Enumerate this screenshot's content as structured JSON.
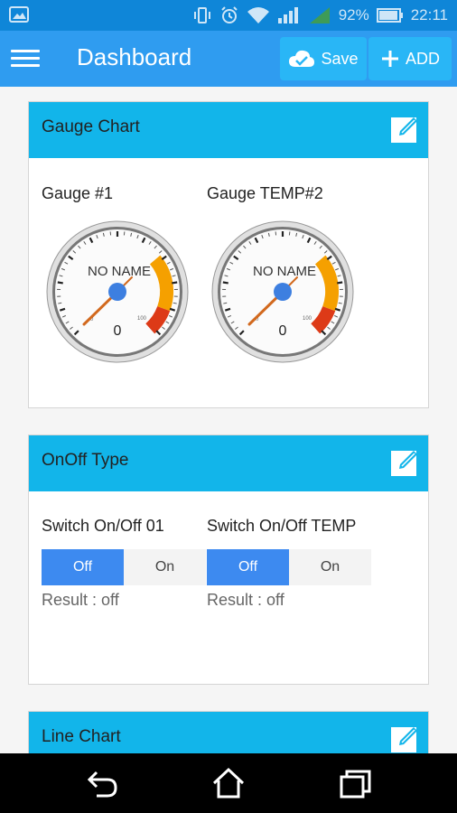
{
  "status_bar": {
    "battery": "92%",
    "time": "22:11"
  },
  "app_bar": {
    "title": "Dashboard",
    "save_label": "Save",
    "add_label": "ADD"
  },
  "panels": {
    "gauge": {
      "title": "Gauge Chart",
      "gauges": [
        {
          "label": "Gauge #1",
          "name": "NO NAME",
          "value": "0",
          "min": "0",
          "max": "100"
        },
        {
          "label": "Gauge TEMP#2",
          "name": "NO NAME",
          "value": "0",
          "min": "0",
          "max": "100"
        }
      ]
    },
    "onoff": {
      "title": "OnOff Type",
      "switches": [
        {
          "label": "Switch On/Off 01",
          "off_label": "Off",
          "on_label": "On",
          "result": "Result : off"
        },
        {
          "label": "Switch On/Off TEMP",
          "off_label": "Off",
          "on_label": "On",
          "result": "Result : off"
        }
      ]
    },
    "line": {
      "title": "Line Chart"
    }
  },
  "icons": {
    "status_left": "image-icon",
    "status_right": [
      "vibrate-icon",
      "alarm-icon",
      "wifi-icon",
      "signal-icon",
      "signal-icon",
      "battery-icon"
    ],
    "nav": [
      "back-icon",
      "home-icon",
      "recents-icon"
    ]
  },
  "colors": {
    "status_bar": "#0f86d8",
    "app_bar": "#2f9cf0",
    "panel_header": "#12b5ea",
    "toggle_active": "#3d8af0"
  }
}
